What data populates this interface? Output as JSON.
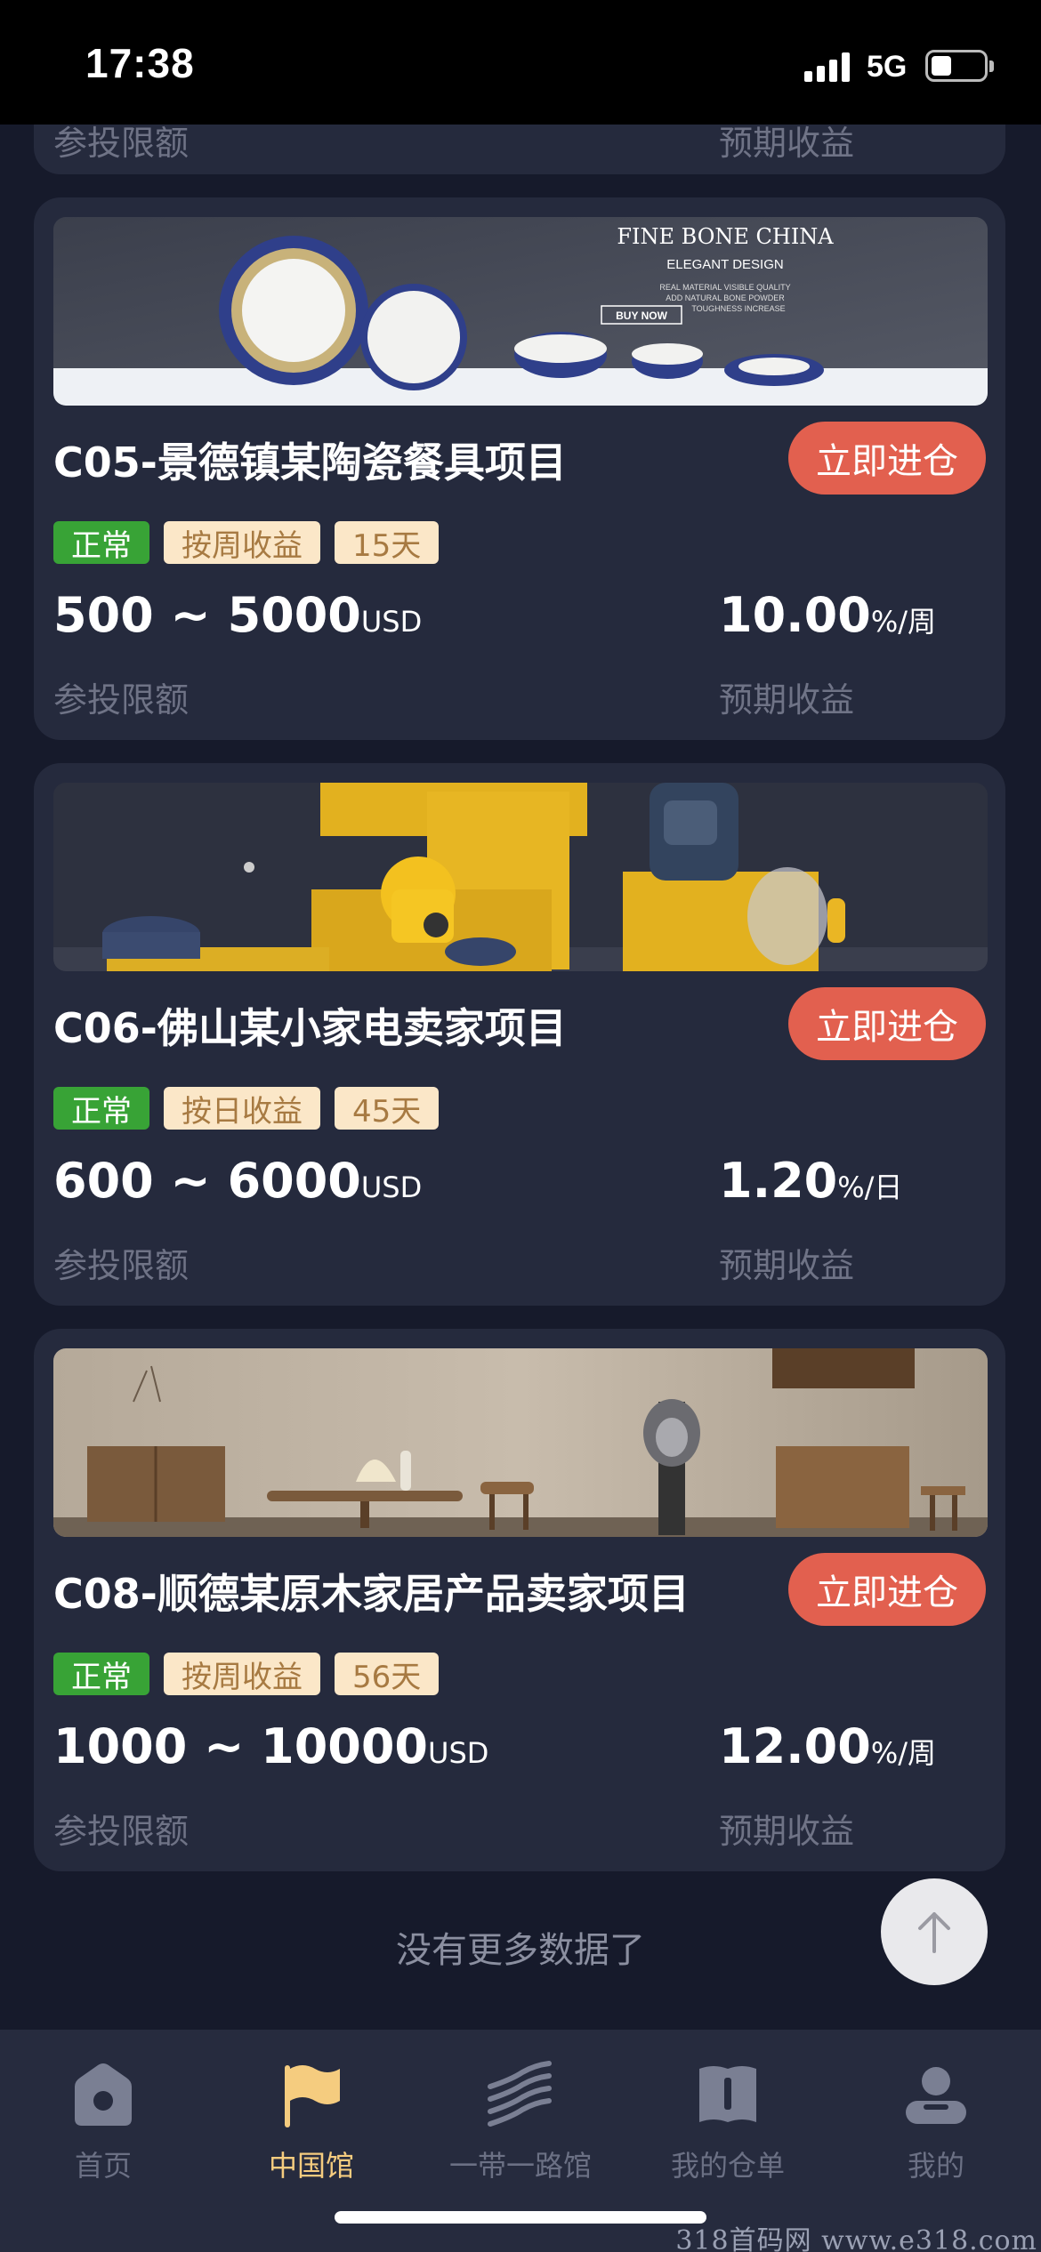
{
  "status_bar": {
    "time": "17:38",
    "network": "5G"
  },
  "partial_card": {
    "limit_label": "参投限额",
    "expected_label": "预期收益"
  },
  "banner_text": {
    "title": "FINE BONE CHINA",
    "subtitle": "ELEGANT DESIGN",
    "line1": "REAL MATERIAL  VISIBLE QUALITY",
    "line2": "ADD NATURAL BONE POWDER",
    "line3": "TOUGHNESS INCREASE",
    "cta": "BUY NOW"
  },
  "products": [
    {
      "title": "C05-景德镇某陶瓷餐具项目",
      "button": "立即进仓",
      "status": "正常",
      "payout": "按周收益",
      "duration": "15天",
      "range": "500 ~ 5000",
      "range_unit": "USD",
      "yield": "10.00",
      "yield_unit": "%/周",
      "limit_label": "参投限额",
      "expected_label": "预期收益"
    },
    {
      "title": "C06-佛山某小家电卖家项目",
      "button": "立即进仓",
      "status": "正常",
      "payout": "按日收益",
      "duration": "45天",
      "range": "600 ~ 6000",
      "range_unit": "USD",
      "yield": "1.20",
      "yield_unit": "%/日",
      "limit_label": "参投限额",
      "expected_label": "预期收益"
    },
    {
      "title": "C08-顺德某原木家居产品卖家项目",
      "button": "立即进仓",
      "status": "正常",
      "payout": "按周收益",
      "duration": "56天",
      "range": "1000 ~ 10000",
      "range_unit": "USD",
      "yield": "12.00",
      "yield_unit": "%/周",
      "limit_label": "参投限额",
      "expected_label": "预期收益"
    }
  ],
  "no_more": "没有更多数据了",
  "tabs": [
    {
      "label": "首页",
      "icon": "home-icon"
    },
    {
      "label": "中国馆",
      "icon": "flag-icon",
      "active": true
    },
    {
      "label": "一带一路馆",
      "icon": "waves-icon"
    },
    {
      "label": "我的仓单",
      "icon": "book-icon"
    },
    {
      "label": "我的",
      "icon": "user-icon"
    }
  ],
  "watermark": "318首码网 www.e318.com",
  "colors": {
    "background": "#161a2b",
    "card": "#252a3d",
    "accent_button": "#e2604f",
    "status_green": "#38a336",
    "tag_cream": "#fbe7c8",
    "tab_active": "#f5cc7f"
  }
}
